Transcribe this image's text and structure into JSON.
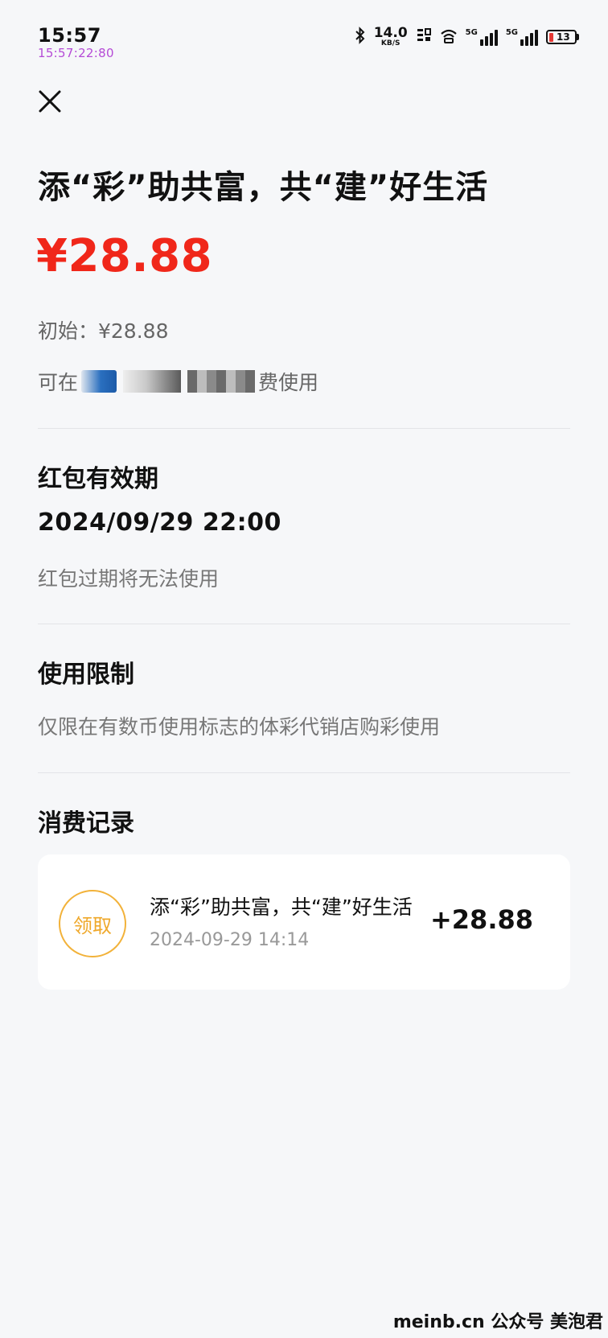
{
  "status_bar": {
    "time": "15:57",
    "subtime": "15:57:22:80",
    "net_speed": "14.0",
    "net_speed_unit": "KB/S",
    "sim1_label": "5G",
    "sim2_label": "5G",
    "battery": "13",
    "battery_color": "#e53935"
  },
  "close_icon": "close-icon",
  "title": "添“彩”助共富，共“建”好生活",
  "amount": "¥28.88",
  "initial_amount": "初始：¥28.88",
  "usable_prefix": "可在",
  "usable_suffix": "费使用",
  "validity": {
    "heading": "红包有效期",
    "date": "2024/09/29 22:00",
    "note": "红包过期将无法使用"
  },
  "restriction": {
    "heading": "使用限制",
    "text": "仅限在有数币使用标志的体彩代销店购彩使用"
  },
  "records": {
    "heading": "消费记录",
    "items": [
      {
        "badge": "领取",
        "title": "添“彩”助共富，共“建”好生活",
        "time": "2024-09-29 14:14",
        "amount": "+28.88"
      }
    ]
  },
  "watermark": "meinb.cn  公众号 美泡君",
  "colors": {
    "amount": "#f0271a",
    "badge": "#efa82a",
    "background": "#f6f7f9"
  }
}
